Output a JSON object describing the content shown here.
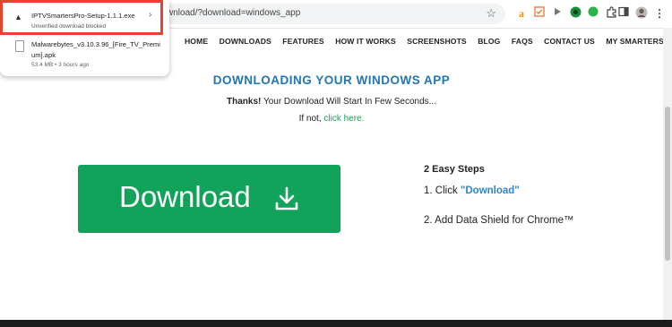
{
  "browser": {
    "url": "wnload/?download=windows_app",
    "icons": [
      "bookmark-star-icon",
      "amazon-extension-icon",
      "extension-icon",
      "play-extension-icon",
      "green-extension-icon",
      "green-status-icon",
      "puzzle-extensions-icon",
      "sidebar-icon",
      "profile-avatar-icon",
      "menu-dots-icon"
    ]
  },
  "downloads": {
    "items": [
      {
        "name": "IPTVSmartersPro-Setup-1.1.1.exe",
        "status": "Unverified download blocked"
      },
      {
        "name": "Malwarebytes_v3.10.3.96_[Fire_TV_Premium].apk",
        "status": "53.4 MB • 3 hours ago"
      }
    ]
  },
  "nav": {
    "items": [
      "HOME",
      "DOWNLOADS",
      "FEATURES",
      "HOW IT WORKS",
      "SCREENSHOTS",
      "BLOG",
      "FAQS",
      "CONTACT US",
      "MY SMARTERS ACCOUNT"
    ]
  },
  "page": {
    "heading": "DOWNLOADING YOUR WINDOWS APP",
    "thanks_bold": "Thanks!",
    "thanks_rest": " Your Download Will Start In Few Seconds...",
    "ifnot_text": "If not, ",
    "click_here": "click here.",
    "download_label": "Download",
    "steps_title": "2 Easy Steps",
    "step1_prefix": "1. Click ",
    "step1_link": "\"Download\"",
    "step2": "2. Add Data Shield for Chrome™"
  },
  "colors": {
    "accent_blue": "#2376b4",
    "download_green": "#11a35a",
    "link_green": "#18a058",
    "highlight_red": "#e8432e"
  }
}
